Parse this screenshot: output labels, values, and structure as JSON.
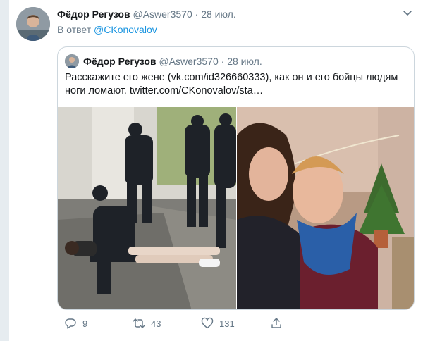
{
  "tweet": {
    "name": "Фёдор Регузов",
    "handle": "@Aswer3570",
    "separator": "·",
    "date": "28 июл.",
    "reply_prefix": "В ответ",
    "reply_mention": "@CKonovalov"
  },
  "quoted": {
    "name": "Фёдор Регузов",
    "handle": "@Aswer3570",
    "separator": "·",
    "date": "28 июл.",
    "text": "Расскажите его жене (vk.com/id326660333), как он и его бойцы людям ноги ломают. twitter.com/CKonovalov/sta…"
  },
  "actions": {
    "replies": "9",
    "retweets": "43",
    "likes": "131"
  },
  "colors": {
    "link": "#1b95e0",
    "secondary_text": "#657786",
    "border": "#ccd6dd",
    "background": "#e6ecf0"
  },
  "icons": [
    "chevron-down-icon",
    "reply-icon",
    "retweet-icon",
    "like-icon",
    "share-icon"
  ]
}
